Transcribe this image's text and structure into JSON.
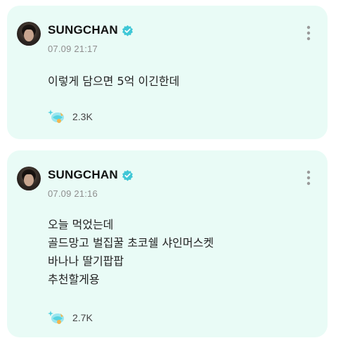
{
  "posts": [
    {
      "author": "SUNGCHAN",
      "timestamp": "07.09 21:17",
      "lines": [
        "이렇게 담으면 5억 이긴한데"
      ],
      "reaction_count": "2.3K",
      "icons": {
        "avatar": "profile-avatar",
        "verified": "verified-badge-icon",
        "more": "more-vertical-icon",
        "reaction": "sparkle-reaction-icon"
      }
    },
    {
      "author": "SUNGCHAN",
      "timestamp": "07.09 21:16",
      "lines": [
        "오늘 먹었는데",
        "골드망고 벌집꿀 초코쉘 샤인머스켓",
        "바나나 딸기팝팝",
        "추천할게용"
      ],
      "reaction_count": "2.7K",
      "icons": {
        "avatar": "profile-avatar",
        "verified": "verified-badge-icon",
        "more": "more-vertical-icon",
        "reaction": "sparkle-reaction-icon"
      }
    }
  ],
  "colors": {
    "card_background": "#e9fbf6",
    "verified_badge": "#3fc7d6",
    "timestamp": "#8e8e8e",
    "reaction_accent": "#56d3e0"
  }
}
